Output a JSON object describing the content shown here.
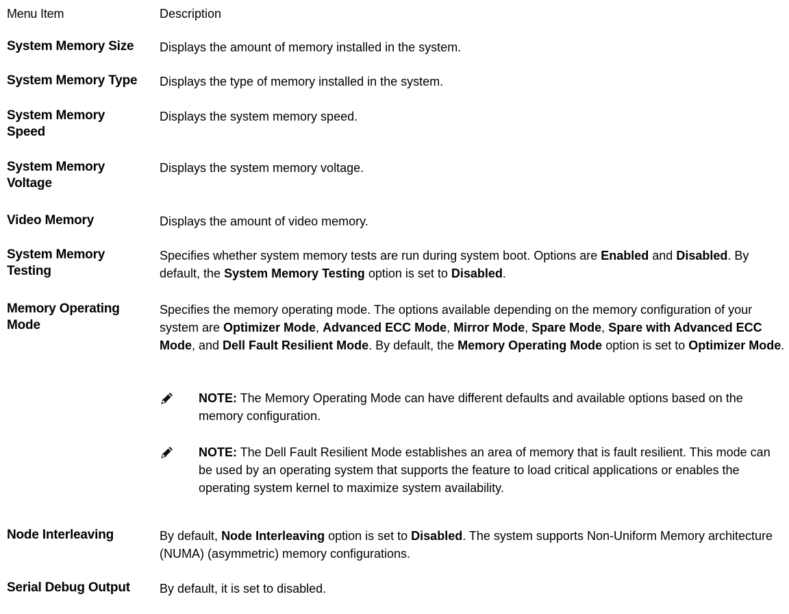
{
  "header": {
    "col_menu_item": "Menu Item",
    "col_description": "Description"
  },
  "rows": [
    {
      "term": "System Memory Size",
      "description": [
        {
          "t": "Displays the amount of memory installed in the system."
        }
      ]
    },
    {
      "term": "System Memory Type",
      "description": [
        {
          "t": "Displays the type of memory installed in the system."
        }
      ]
    },
    {
      "term": "System Memory Speed",
      "description": [
        {
          "t": "Displays the system memory speed."
        }
      ]
    },
    {
      "term": "System Memory Voltage",
      "description": [
        {
          "t": "Displays the system memory voltage."
        }
      ]
    },
    {
      "term": "Video Memory",
      "description": [
        {
          "t": "Displays the amount of video memory."
        }
      ]
    },
    {
      "term": "System Memory Testing",
      "description": [
        {
          "t": "Specifies whether system memory tests are run during system boot. Options are "
        },
        {
          "t": "Enabled",
          "b": true
        },
        {
          "t": " and "
        },
        {
          "t": "Disabled",
          "b": true
        },
        {
          "t": ". By default, the "
        },
        {
          "t": "System Memory Testing",
          "b": true
        },
        {
          "t": " option is set to "
        },
        {
          "t": "Disabled",
          "b": true
        },
        {
          "t": "."
        }
      ]
    },
    {
      "term": "Memory Operating Mode",
      "description": [
        {
          "t": "Specifies the memory operating mode. The options available depending on the memory configuration of your system are "
        },
        {
          "t": "Optimizer Mode",
          "b": true
        },
        {
          "t": ", "
        },
        {
          "t": "Advanced ECC Mode",
          "b": true
        },
        {
          "t": ", "
        },
        {
          "t": "Mirror Mode",
          "b": true
        },
        {
          "t": ", "
        },
        {
          "t": "Spare Mode",
          "b": true
        },
        {
          "t": ", "
        },
        {
          "t": "Spare with Advanced ECC Mode",
          "b": true
        },
        {
          "t": ", and "
        },
        {
          "t": "Dell Fault Resilient Mode",
          "b": true
        },
        {
          "t": ". By default, the "
        },
        {
          "t": "Memory Operating Mode",
          "b": true
        },
        {
          "t": " option is set to "
        },
        {
          "t": "Optimizer Mode",
          "b": true
        },
        {
          "t": "."
        }
      ],
      "notes": [
        {
          "icon": "note-pencil-icon",
          "label": "NOTE:",
          "text": " The Memory Operating Mode can have different defaults and available options based on the memory configuration."
        },
        {
          "icon": "note-pencil-icon",
          "label": "NOTE:",
          "text": " The Dell Fault Resilient Mode establishes an area of memory that is fault resilient. This mode can be used by an operating system that supports the feature to load critical applications or enables the operating system kernel to maximize system availability."
        }
      ]
    },
    {
      "term": "Node Interleaving",
      "description": [
        {
          "t": "By default, "
        },
        {
          "t": "Node Interleaving",
          "b": true
        },
        {
          "t": " option is set to "
        },
        {
          "t": "Disabled",
          "b": true
        },
        {
          "t": ". The system supports Non-Uniform Memory architecture (NUMA) (asymmetric) memory configurations."
        }
      ]
    },
    {
      "term": "Serial Debug Output",
      "description": [
        {
          "t": "By default, it is set to disabled."
        }
      ]
    }
  ]
}
